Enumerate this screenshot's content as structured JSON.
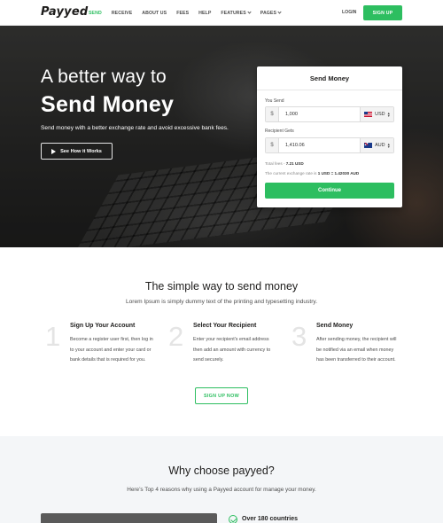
{
  "header": {
    "logo": "Payyed",
    "nav": [
      {
        "label": "SEND",
        "active": true
      },
      {
        "label": "RECEIVE"
      },
      {
        "label": "ABOUT US"
      },
      {
        "label": "FEES"
      },
      {
        "label": "HELP"
      },
      {
        "label": "FEATURES",
        "dropdown": true
      },
      {
        "label": "PAGES",
        "dropdown": true
      }
    ],
    "login_label": "LOGIN",
    "signup_label": "SIGN UP"
  },
  "hero": {
    "title_line1": "A better way to",
    "title_line2": "Send Money",
    "subtitle": "Send money with a better exchange rate and avoid excessive bank fees.",
    "how_button_label": "See How it Works"
  },
  "send_card": {
    "title": "Send Money",
    "you_send_label": "You Send",
    "you_send_symbol": "$",
    "you_send_amount": "1,000",
    "you_send_currency": "USD",
    "recipient_label": "Recipient Gets",
    "recipient_symbol": "$",
    "recipient_amount": "1,410.06",
    "recipient_currency": "AUD",
    "fees_label": "Total fees -",
    "fees_value": "7.21 USD",
    "rate_label": "The current exchange rate is",
    "rate_value": "1 USD = 1.42030 AUD",
    "continue_label": "Continue"
  },
  "how_it_works": {
    "title": "The simple way to send money",
    "subtitle": "Lorem Ipsum is simply dummy text of the printing and typesetting industry.",
    "steps": [
      {
        "num": "1",
        "title": "Sign Up Your Account",
        "text": "Become a register user first, then log in to your account and enter your card or bank details that is required for you."
      },
      {
        "num": "2",
        "title": "Select Your Recipient",
        "text": "Enter your recipient's email address then add an amount with currency to send securely."
      },
      {
        "num": "3",
        "title": "Send Money",
        "text": "After sending money, the recipient will be notified via an email when money has been transferred to their account."
      }
    ],
    "signup_now_label": "SIGN UP NOW"
  },
  "why_choose": {
    "title": "Why choose payyed?",
    "subtitle": "Here’s Top 4 reasons why using a Payyed account for manage your money.",
    "reasons": [
      {
        "title": "Over 180 countries"
      }
    ]
  },
  "colors": {
    "accent": "#2dbe60",
    "text_dark": "#1e1d1c",
    "text_muted": "#4c4c4c",
    "section_bg": "#f4f6f8"
  }
}
